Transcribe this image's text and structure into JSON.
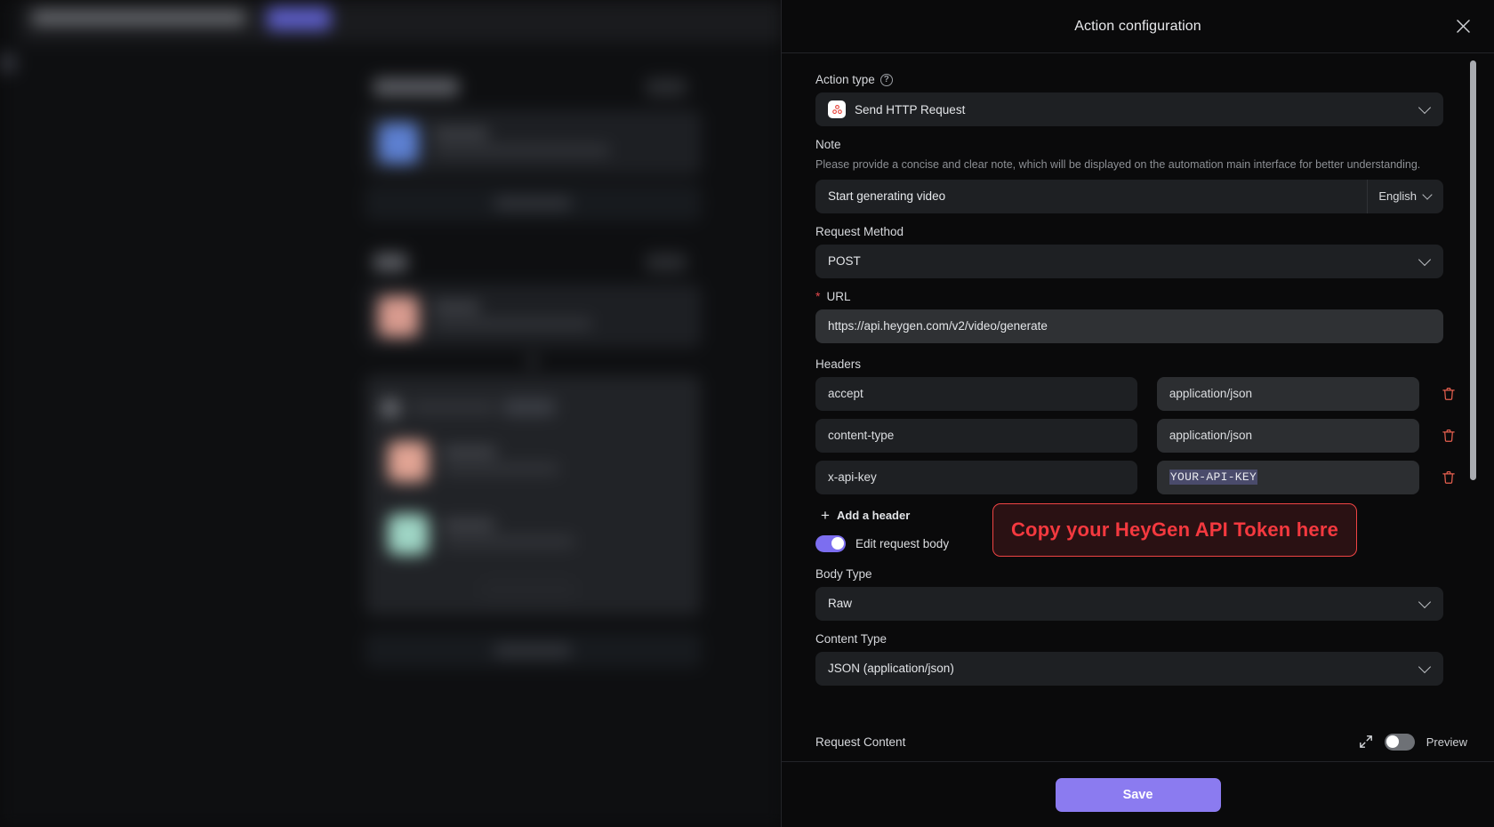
{
  "panel": {
    "title": "Action configuration",
    "close_icon": "close-icon"
  },
  "form": {
    "action_type": {
      "label": "Action type",
      "help_icon": "question-mark-icon",
      "value": "Send HTTP Request",
      "app_icon": "send-http-request-icon"
    },
    "note": {
      "label": "Note",
      "helper": "Please provide a concise and clear note, which will be displayed on the automation main interface for better understanding.",
      "value": "Start generating video",
      "language": "English"
    },
    "request_method": {
      "label": "Request Method",
      "value": "POST"
    },
    "url": {
      "label": "URL",
      "value": "https://api.heygen.com/v2/video/generate",
      "required": true
    },
    "headers": {
      "label": "Headers",
      "rows": [
        {
          "key": "accept",
          "value": "application/json",
          "selected": false
        },
        {
          "key": "content-type",
          "value": "application/json",
          "selected": false
        },
        {
          "key": "x-api-key",
          "value": "YOUR-API-KEY",
          "selected": true
        }
      ],
      "add_label": "Add a header"
    },
    "edit_request_body": {
      "label": "Edit request body",
      "enabled": true
    },
    "body_type": {
      "label": "Body Type",
      "value": "Raw"
    },
    "content_type": {
      "label": "Content Type",
      "value": "JSON (application/json)"
    },
    "request_content": {
      "label": "Request Content",
      "preview_label": "Preview",
      "preview_enabled": false,
      "expand_icon": "expand-icon"
    }
  },
  "annotation": {
    "text": "Copy your HeyGen API Token here"
  },
  "footer": {
    "save_label": "Save"
  },
  "colors": {
    "accent": "#8b7bf0",
    "toggle_on": "#7c6ef0",
    "annotation_red": "#f4393f",
    "annotation_bg": "#2a1113",
    "delete_icon": "#e8604f",
    "required_star": "#e5484d",
    "panel_bg": "#0a0a0b",
    "field_bg": "#1e2023",
    "field_bg_alt": "#2c2e31"
  }
}
